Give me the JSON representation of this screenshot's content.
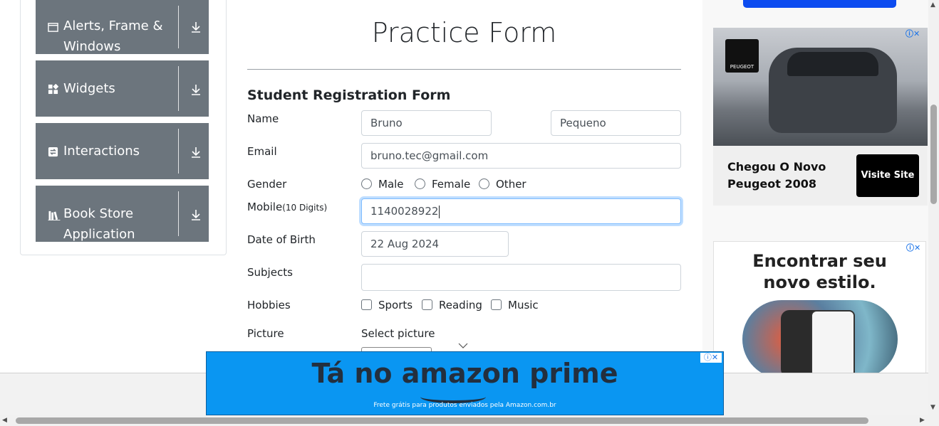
{
  "sidebar": {
    "items": [
      {
        "label": "Alerts, Frame & Windows",
        "icon": "window-icon"
      },
      {
        "label": "Widgets",
        "icon": "widgets-icon"
      },
      {
        "label": "Interactions",
        "icon": "interactions-icon"
      },
      {
        "label": "Book Store Application",
        "icon": "books-icon"
      }
    ]
  },
  "form": {
    "page_title": "Practice Form",
    "subtitle": "Student Registration Form",
    "name_label": "Name",
    "first_name": "Bruno",
    "last_name": "Pequeno",
    "email_label": "Email",
    "email": "bruno.tec@gmail.com",
    "gender_label": "Gender",
    "gender_options": [
      "Male",
      "Female",
      "Other"
    ],
    "mobile_label": "Mobile",
    "mobile_hint": "(10 Digits)",
    "mobile": "1140028922",
    "dob_label": "Date of Birth",
    "dob": "22 Aug 2024",
    "subjects_label": "Subjects",
    "subjects": "",
    "hobbies_label": "Hobbies",
    "hobbies_options": [
      "Sports",
      "Reading",
      "Music"
    ],
    "picture_label": "Picture",
    "picture_prompt": "Select picture"
  },
  "ads": {
    "peugeot": {
      "headline_line1": "Chegou O Novo",
      "headline_line2": "Peugeot 2008",
      "cta": "Visite Site",
      "brand": "PEUGEOT"
    },
    "style_ad": {
      "line1": "Encontrar seu",
      "line2": "novo estilo."
    },
    "amazon": {
      "headline": "Tá no amazon prime",
      "subtext": "Frete grátis para produtos enviados pela Amazon.com.br"
    }
  },
  "colors": {
    "sidebar_card": "#6c757d",
    "focus_border": "#80bdff",
    "amazon_bg": "#0a96f2",
    "ad_cta_bg": "#000000"
  }
}
